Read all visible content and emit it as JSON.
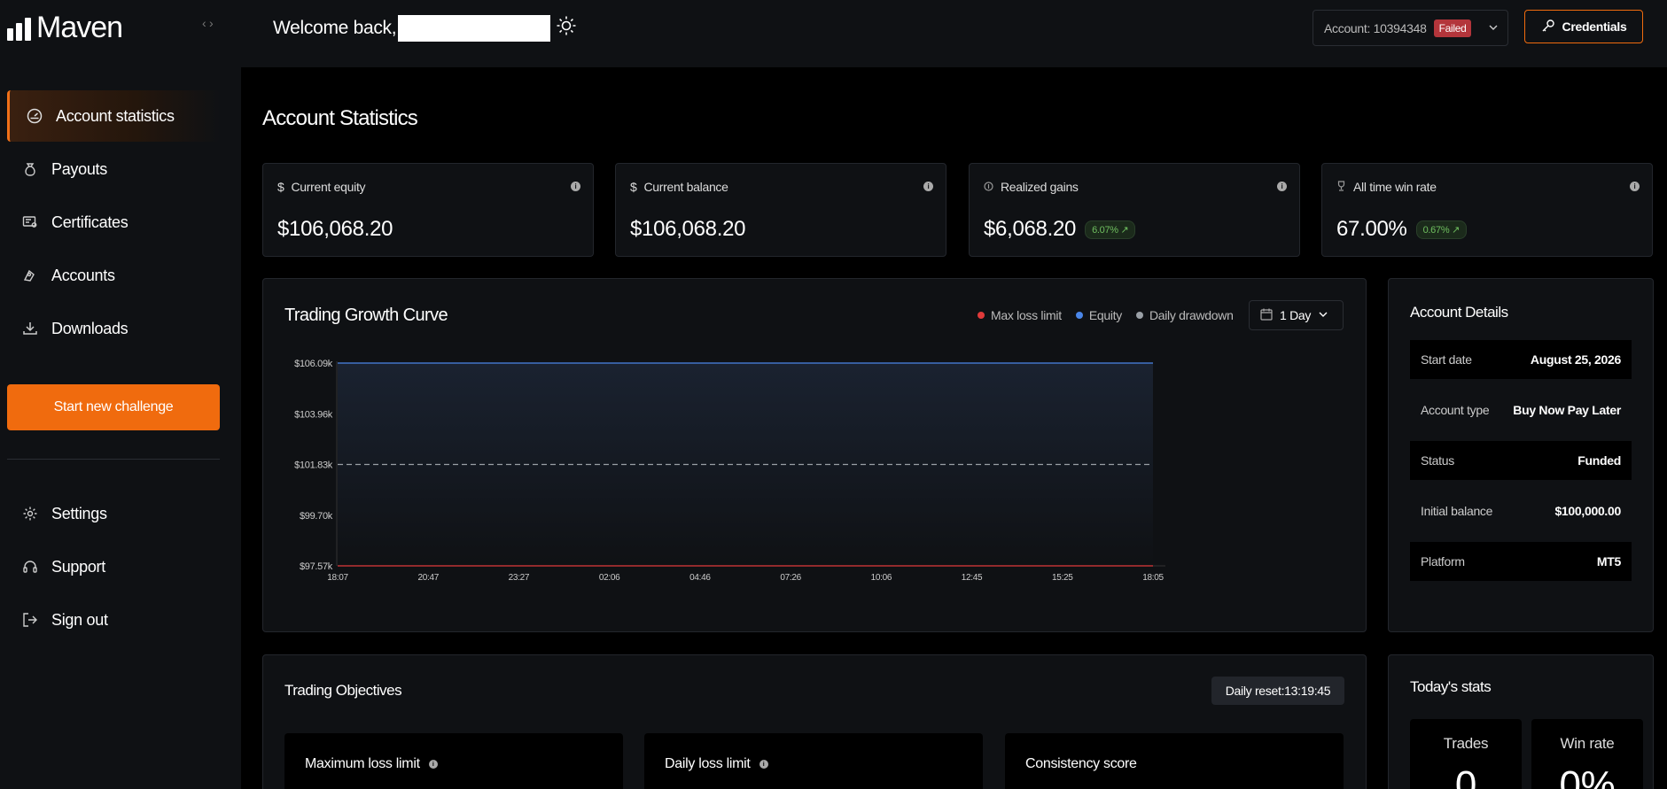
{
  "app": {
    "name": "Maven"
  },
  "sidebar": {
    "items": [
      {
        "label": "Account statistics",
        "icon": "gauge-icon",
        "active": true
      },
      {
        "label": "Payouts",
        "icon": "money-bag-icon"
      },
      {
        "label": "Certificates",
        "icon": "certificate-icon"
      },
      {
        "label": "Accounts",
        "icon": "accounts-icon"
      },
      {
        "label": "Downloads",
        "icon": "download-icon"
      }
    ],
    "cta_label": "Start new challenge",
    "bottom_items": [
      {
        "label": "Settings",
        "icon": "gear-icon"
      },
      {
        "label": "Support",
        "icon": "headset-icon"
      },
      {
        "label": "Sign out",
        "icon": "sign-out-icon"
      }
    ]
  },
  "header": {
    "welcome": "Welcome back,",
    "account_label": "Account: 10394348",
    "account_status": "Failed",
    "credentials_label": "Credentials"
  },
  "page": {
    "title": "Account Statistics"
  },
  "stats": [
    {
      "label": "Current equity",
      "icon": "dollar-icon",
      "value": "$106,068.20",
      "change": ""
    },
    {
      "label": "Current balance",
      "icon": "dollar-icon",
      "value": "$106,068.20",
      "change": ""
    },
    {
      "label": "Realized gains",
      "icon": "coin-icon",
      "value": "$6,068.20",
      "change": "6.07%"
    },
    {
      "label": "All time win rate",
      "icon": "trophy-icon",
      "value": "67.00%",
      "change": "0.67%"
    }
  ],
  "growth": {
    "title": "Trading Growth Curve",
    "legend": [
      {
        "name": "Max loss limit",
        "color": "#e03a3a"
      },
      {
        "name": "Equity",
        "color": "#4a86e8"
      },
      {
        "name": "Daily drawdown",
        "color": "#9aa0a6"
      }
    ],
    "range": "1 Day"
  },
  "chart_data": {
    "type": "line",
    "title": "Trading Growth Curve",
    "x": [
      "18:07",
      "20:47",
      "23:27",
      "02:06",
      "04:46",
      "07:26",
      "10:06",
      "12:45",
      "15:25",
      "18:05"
    ],
    "y_ticks": [
      "$106.09k",
      "$103.96k",
      "$101.83k",
      "$99.70k",
      "$97.57k"
    ],
    "ylim": [
      97570,
      106090
    ],
    "series": [
      {
        "name": "Equity",
        "color": "#4a86e8",
        "values": [
          106090,
          106090,
          106090,
          106090,
          106090,
          106090,
          106090,
          106090,
          106090,
          106090
        ]
      },
      {
        "name": "Daily drawdown",
        "color": "#9aa0a6",
        "dashed": true,
        "values": [
          101830,
          101830,
          101830,
          101830,
          101830,
          101830,
          101830,
          101830,
          101830,
          101830
        ]
      },
      {
        "name": "Max loss limit",
        "color": "#e03a3a",
        "values": [
          97570,
          97570,
          97570,
          97570,
          97570,
          97570,
          97570,
          97570,
          97570,
          97570
        ]
      }
    ],
    "grid": false
  },
  "details": {
    "title": "Account Details",
    "rows": [
      {
        "label": "Start date",
        "value": "August 25, 2026"
      },
      {
        "label": "Account type",
        "value": "Buy Now Pay Later"
      },
      {
        "label": "Status",
        "value": "Funded"
      },
      {
        "label": "Initial balance",
        "value": "$100,000.00"
      },
      {
        "label": "Platform",
        "value": "MT5"
      }
    ]
  },
  "objectives": {
    "title": "Trading Objectives",
    "reset": "Daily reset:13:19:45",
    "items": [
      {
        "label": "Maximum loss limit"
      },
      {
        "label": "Daily loss limit"
      },
      {
        "label": "Consistency score"
      }
    ]
  },
  "today": {
    "title": "Today's stats",
    "items": [
      {
        "label": "Trades",
        "value": "0"
      },
      {
        "label": "Win rate",
        "value": "0%"
      }
    ]
  }
}
